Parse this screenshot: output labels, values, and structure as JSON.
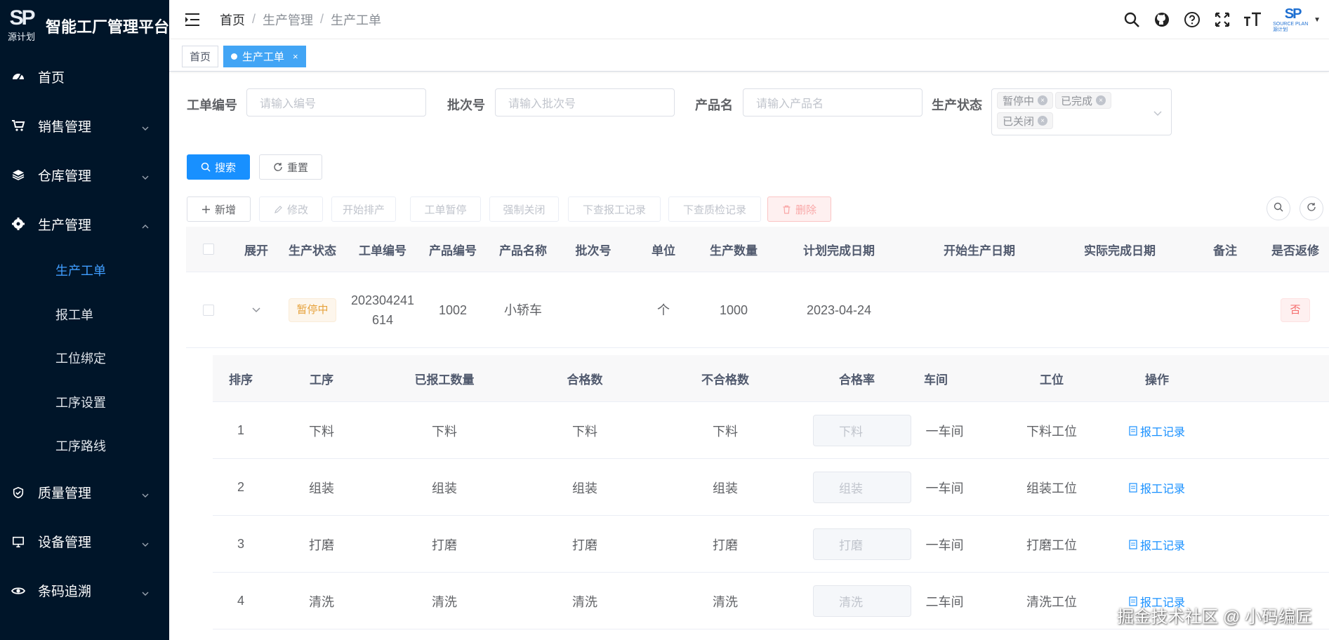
{
  "app": {
    "logo_mark": "SP",
    "logo_sub": "源计划",
    "title": "智能工厂管理平台"
  },
  "sidebar": {
    "items": [
      {
        "label": "首页",
        "icon": "dashboard-icon"
      },
      {
        "label": "销售管理",
        "icon": "cart-icon"
      },
      {
        "label": "仓库管理",
        "icon": "layers-icon"
      },
      {
        "label": "生产管理",
        "icon": "gear-icon"
      }
    ],
    "sub_items": [
      {
        "label": "生产工单",
        "active": true
      },
      {
        "label": "报工单"
      },
      {
        "label": "工位绑定"
      },
      {
        "label": "工序设置"
      },
      {
        "label": "工序路线"
      }
    ],
    "items_after": [
      {
        "label": "质量管理",
        "icon": "shield-icon"
      },
      {
        "label": "设备管理",
        "icon": "monitor-icon"
      },
      {
        "label": "条码追溯",
        "icon": "eye-icon"
      }
    ]
  },
  "header": {
    "breadcrumb": [
      "首页",
      "生产管理",
      "生产工单"
    ],
    "avatar_mark": "SP",
    "avatar_sub": "SOURCE PLAN 源计划"
  },
  "tags": {
    "home": "首页",
    "active": "生产工单",
    "close": "×"
  },
  "search": {
    "order_no_label": "工单编号",
    "order_no_placeholder": "请输入编号",
    "batch_label": "批次号",
    "batch_placeholder": "请输入批次号",
    "product_label": "产品名",
    "product_placeholder": "请输入产品名",
    "status_label": "生产状态",
    "status_selected": [
      "暂停中",
      "已完成",
      "已关闭"
    ],
    "search_btn": "搜索",
    "reset_btn": "重置"
  },
  "toolbar": {
    "add": "新增",
    "edit": "修改",
    "start_schedule": "开始排产",
    "pause": "工单暂停",
    "force_close": "强制关闭",
    "view_reports": "下查报工记录",
    "view_qc": "下查质检记录",
    "delete": "删除"
  },
  "table": {
    "headers": [
      "展开",
      "生产状态",
      "工单编号",
      "产品编号",
      "产品名称",
      "批次号",
      "单位",
      "生产数量",
      "计划完成日期",
      "开始生产日期",
      "实际完成日期",
      "备注",
      "是否返修"
    ],
    "row": {
      "status": "暂停中",
      "order_no_line1": "202304241",
      "order_no_line2": "614",
      "product_no": "1002",
      "product_name": "小轿车",
      "batch": "",
      "unit": "个",
      "quantity": "1000",
      "plan_date": "2023-04-24",
      "start_date": "",
      "actual_date": "",
      "remark": "",
      "rework": "否"
    }
  },
  "inner_table": {
    "headers": [
      "排序",
      "工序",
      "已报工数量",
      "合格数",
      "不合格数",
      "合格率",
      "车间",
      "工位",
      "操作"
    ],
    "link_label": "报工记录",
    "rows": [
      {
        "order": "1",
        "process": "下料",
        "reported": "下料",
        "qualified": "下料",
        "unqualified": "下料",
        "rate": "下料",
        "workshop": "一车间",
        "station": "下料工位"
      },
      {
        "order": "2",
        "process": "组装",
        "reported": "组装",
        "qualified": "组装",
        "unqualified": "组装",
        "rate": "组装",
        "workshop": "一车间",
        "station": "组装工位"
      },
      {
        "order": "3",
        "process": "打磨",
        "reported": "打磨",
        "qualified": "打磨",
        "unqualified": "打磨",
        "rate": "打磨",
        "workshop": "一车间",
        "station": "打磨工位"
      },
      {
        "order": "4",
        "process": "清洗",
        "reported": "清洗",
        "qualified": "清洗",
        "unqualified": "清洗",
        "rate": "清洗",
        "workshop": "二车间",
        "station": "清洗工位"
      }
    ]
  },
  "watermark": "掘金技术社区 @ 小码编匠"
}
